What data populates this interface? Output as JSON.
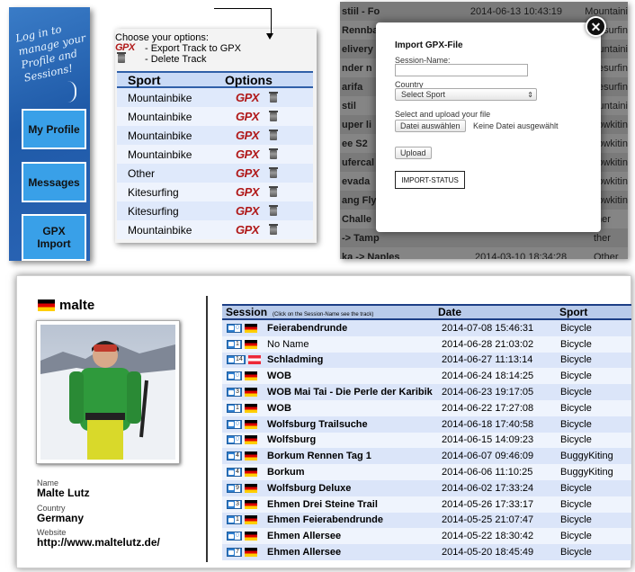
{
  "sidebar": {
    "tagline": "Log in to manage your Profile and Sessions!",
    "buttons": {
      "profile": "My Profile",
      "messages": "Messages",
      "gpx_line1": "GPX",
      "gpx_line2": "Import"
    }
  },
  "options": {
    "legend_title": "Choose your options:",
    "export_label": "- Export Track to GPX",
    "delete_label": "- Delete Track",
    "gpx_logo": "GPX",
    "headers": {
      "sport": "Sport",
      "options": "Options"
    },
    "rows": [
      "Mountainbike",
      "Mountainbike",
      "Mountainbike",
      "Mountainbike",
      "Other",
      "Kitesurfing",
      "Kitesurfing",
      "Mountainbike"
    ]
  },
  "background_sessions": [
    {
      "name": "stiil - Fo",
      "date": "2014-06-13 10:43:19",
      "sport": "Mountaini"
    },
    {
      "name": "Rennba",
      "date": "",
      "sport": "itesurfin"
    },
    {
      "name": "elivery",
      "date": "",
      "sport": "ountaini"
    },
    {
      "name": "nder n",
      "date": "",
      "sport": "itesurfin"
    },
    {
      "name": "arifa",
      "date": "",
      "sport": "itesurfin"
    },
    {
      "name": "stil",
      "date": "",
      "sport": "ountaini"
    },
    {
      "name": "uper li",
      "date": "",
      "sport": "nowkitin"
    },
    {
      "name": "ee S2",
      "date": "",
      "sport": "nowkitin"
    },
    {
      "name": "ufercal",
      "date": "",
      "sport": "nowkitin"
    },
    {
      "name": "evada",
      "date": "",
      "sport": "nowkitin"
    },
    {
      "name": "ang Fly",
      "date": "",
      "sport": "nowkitin"
    },
    {
      "name": "Challe",
      "date": "",
      "sport": "ther"
    },
    {
      "name": "-> Tamp",
      "date": "",
      "sport": "ther"
    },
    {
      "name": "ka -> Naples",
      "date": "2014-03-10 18:34:28",
      "sport": "Other"
    },
    {
      "name": "",
      "date": "",
      "sport": ""
    }
  ],
  "modal": {
    "title": "Import GPX-File",
    "session_name_label": "Session-Name:",
    "session_name_value": "",
    "country_label": "Country",
    "sport_select": "Select Sport",
    "upload_label": "Select and upload your file",
    "file_button": "Datei auswählen",
    "file_status": "Keine Datei ausgewählt",
    "upload_button": "Upload",
    "import_status": "IMPORT-STATUS",
    "close_glyph": "✕"
  },
  "profile": {
    "username": "malte",
    "name_label": "Name",
    "name_value": "Malte Lutz",
    "country_label": "Country",
    "country_value": "Germany",
    "website_label": "Website",
    "website_value": "http://www.maltelutz.de/"
  },
  "sessions": {
    "headers": {
      "session": "Session",
      "session_hint": "(Click on the Session-Name see the track)",
      "date": "Date",
      "sport": "Sport"
    },
    "rows": [
      {
        "photos": "0",
        "flag": "de",
        "name": "Feierabendrunde",
        "bold": true,
        "date": "2014-07-08 15:46:31",
        "sport": "Bicycle"
      },
      {
        "photos": "1",
        "flag": "de",
        "name": "No Name",
        "bold": false,
        "date": "2014-06-28 21:03:02",
        "sport": "Bicycle"
      },
      {
        "photos": "14",
        "flag": "at",
        "name": "Schladming",
        "bold": true,
        "date": "2014-06-27 11:13:14",
        "sport": "Bicycle"
      },
      {
        "photos": "0",
        "flag": "de",
        "name": "WOB",
        "bold": true,
        "date": "2014-06-24 18:14:25",
        "sport": "Bicycle"
      },
      {
        "photos": "3",
        "flag": "de",
        "name": "WOB Mai Tai - Die Perle der Karibik",
        "bold": true,
        "date": "2014-06-23 19:17:05",
        "sport": "Bicycle"
      },
      {
        "photos": "1",
        "flag": "de",
        "name": "WOB",
        "bold": true,
        "date": "2014-06-22 17:27:08",
        "sport": "Bicycle"
      },
      {
        "photos": "0",
        "flag": "de",
        "name": "Wolfsburg Trailsuche",
        "bold": true,
        "date": "2014-06-18 17:40:58",
        "sport": "Bicycle"
      },
      {
        "photos": "0",
        "flag": "de",
        "name": "Wolfsburg",
        "bold": true,
        "date": "2014-06-15 14:09:23",
        "sport": "Bicycle"
      },
      {
        "photos": "4",
        "flag": "de",
        "name": "Borkum Rennen Tag 1",
        "bold": true,
        "date": "2014-06-07 09:46:09",
        "sport": "BuggyKiting"
      },
      {
        "photos": "4",
        "flag": "de",
        "name": "Borkum",
        "bold": true,
        "date": "2014-06-06 11:10:25",
        "sport": "BuggyKiting"
      },
      {
        "photos": "9",
        "flag": "de",
        "name": "Wolfsburg Deluxe",
        "bold": true,
        "date": "2014-06-02 17:33:24",
        "sport": "Bicycle"
      },
      {
        "photos": "3",
        "flag": "de",
        "name": "Ehmen Drei Steine Trail",
        "bold": true,
        "date": "2014-05-26 17:33:17",
        "sport": "Bicycle"
      },
      {
        "photos": "1",
        "flag": "de",
        "name": "Ehmen Feierabendrunde",
        "bold": true,
        "date": "2014-05-25 21:07:47",
        "sport": "Bicycle"
      },
      {
        "photos": "0",
        "flag": "de",
        "name": "Ehmen Allersee",
        "bold": true,
        "date": "2014-05-22 18:30:42",
        "sport": "Bicycle"
      },
      {
        "photos": "7",
        "flag": "de",
        "name": "Ehmen Allersee",
        "bold": true,
        "date": "2014-05-20 18:45:49",
        "sport": "Bicycle"
      }
    ]
  },
  "colors": {
    "sidebar_blue": "#1f5aa8",
    "button_blue": "#39a0e8",
    "gpx_red": "#b01818",
    "table_header": "#c9daf6",
    "header_border": "#1d3f86"
  }
}
